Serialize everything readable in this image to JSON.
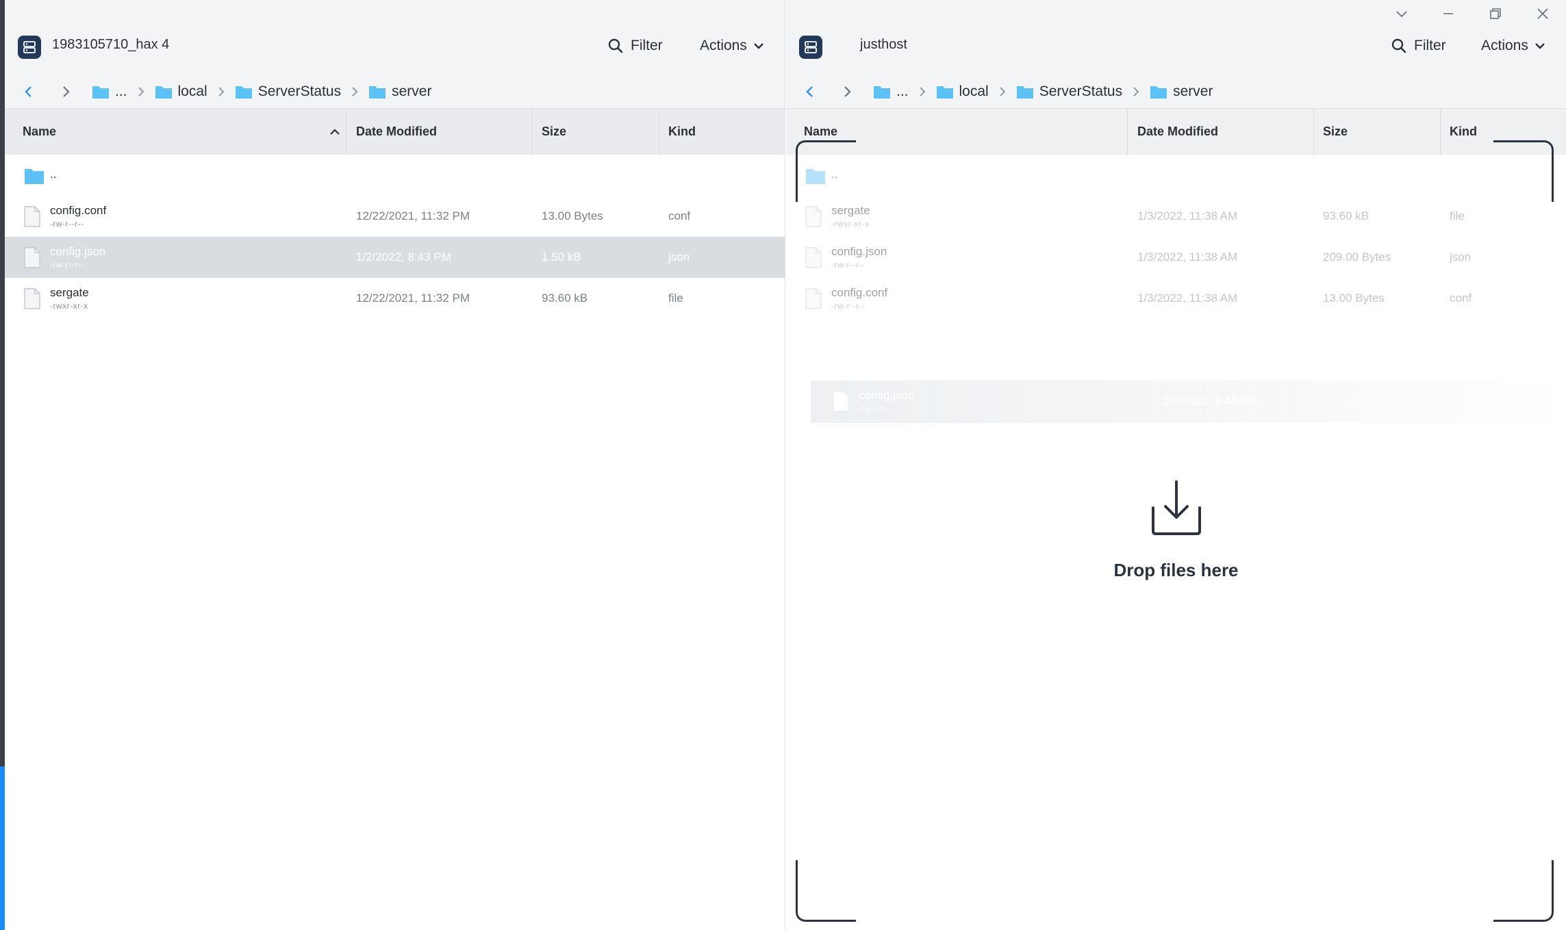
{
  "left": {
    "host": "1983105710_hax 4",
    "filter_label": "Filter",
    "actions_label": "Actions",
    "breadcrumb": [
      "...",
      "local",
      "ServerStatus",
      "server"
    ],
    "columns": {
      "name": "Name",
      "date": "Date Modified",
      "size": "Size",
      "kind": "Kind"
    },
    "rows": [
      {
        "name": "..",
        "perm": "",
        "date": "",
        "size": "",
        "kind": ""
      },
      {
        "name": "config.conf",
        "perm": "-rw-r--r--",
        "date": "12/22/2021, 11:32 PM",
        "size": "13.00 Bytes",
        "kind": "conf"
      },
      {
        "name": "config.json",
        "perm": "-rw-r--r--",
        "date": "1/2/2022, 8:43 PM",
        "size": "1.50 kB",
        "kind": "json"
      },
      {
        "name": "sergate",
        "perm": "-rwxr-xr-x",
        "date": "12/22/2021, 11:32 PM",
        "size": "93.60 kB",
        "kind": "file"
      }
    ]
  },
  "right": {
    "host": "justhost",
    "filter_label": "Filter",
    "actions_label": "Actions",
    "breadcrumb": [
      "...",
      "local",
      "ServerStatus",
      "server"
    ],
    "columns": {
      "name": "Name",
      "date": "Date Modified",
      "size": "Size",
      "kind": "Kind"
    },
    "rows": [
      {
        "name": "..",
        "perm": "",
        "date": "",
        "size": "",
        "kind": ""
      },
      {
        "name": "sergate",
        "perm": "-rwxr-xr-x",
        "date": "1/3/2022, 11:38 AM",
        "size": "93.60 kB",
        "kind": "file"
      },
      {
        "name": "config.json",
        "perm": "-rw-r--r--",
        "date": "1/3/2022, 11:38 AM",
        "size": "209.00 Bytes",
        "kind": "json"
      },
      {
        "name": "config.conf",
        "perm": "-rw-r--r--",
        "date": "1/3/2022, 11:38 AM",
        "size": "13.00 Bytes",
        "kind": "conf"
      }
    ],
    "drag_ghost": {
      "name": "config.json",
      "perm": "-rw-r--r--",
      "date": "1/2/2022, 8:43 PM",
      "size": "1.50 kB"
    },
    "drop_text": "Drop files here"
  },
  "icons": {
    "host": "server-icon",
    "filter": "search-icon",
    "actions": "chevron-down-icon",
    "back": "chevron-left-icon",
    "forward": "chevron-right-icon",
    "folder": "folder-icon",
    "file": "file-icon",
    "drop": "download-icon"
  },
  "colors": {
    "accent": "#1a8cff",
    "folder": "#5cc1f5",
    "selected_row": "#d9dde1",
    "host_icon": "#22395a"
  }
}
